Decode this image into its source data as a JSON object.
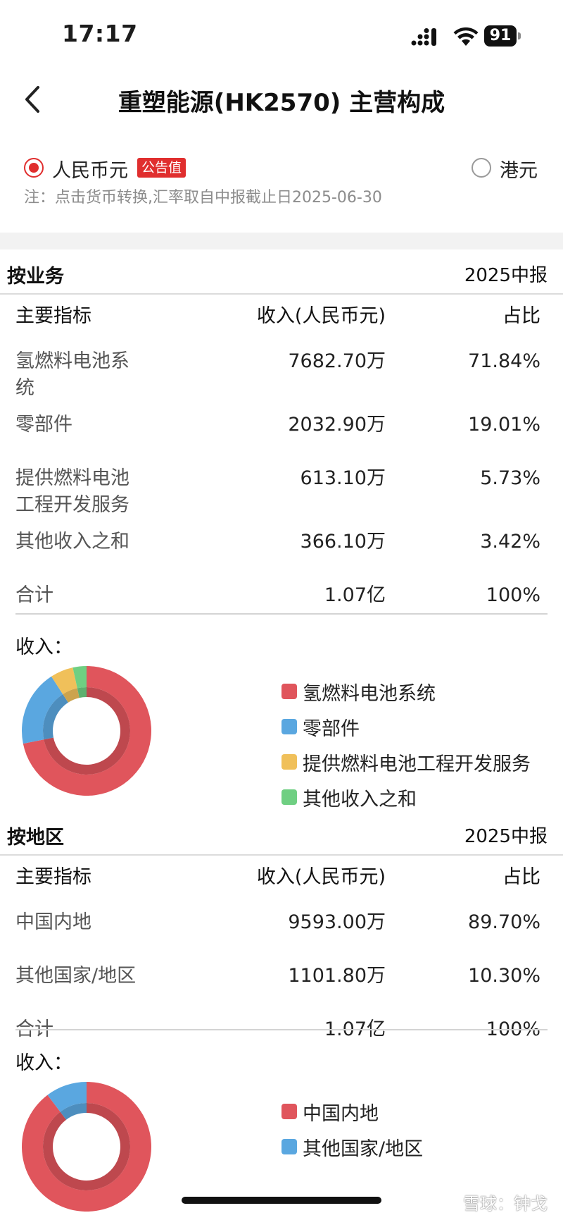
{
  "status": {
    "time": "17:17",
    "battery": "91"
  },
  "nav": {
    "title": "重塑能源(HK2570) 主营构成"
  },
  "currency": {
    "options": [
      {
        "label": "人民币元",
        "badge": "公告值",
        "selected": true
      },
      {
        "label": "港元",
        "selected": false
      }
    ],
    "note": "注：点击货币转换,汇率取自中报截止日2025-06-30"
  },
  "business": {
    "title": "按业务",
    "period": "2025中报",
    "headers": [
      "主要指标",
      "收入(人民币元)",
      "占比"
    ],
    "rows": [
      {
        "name": "氢燃料电池系统",
        "revenue": "7682.70万",
        "ratio": "71.84%"
      },
      {
        "name": "零部件",
        "revenue": "2032.90万",
        "ratio": "19.01%"
      },
      {
        "name": "提供燃料电池工程开发服务",
        "revenue": "613.10万",
        "ratio": "5.73%"
      },
      {
        "name": "其他收入之和",
        "revenue": "366.10万",
        "ratio": "3.42%"
      }
    ],
    "total": {
      "name": "合计",
      "revenue": "1.07亿",
      "ratio": "100%"
    },
    "revenue_label": "收入：",
    "legend": [
      "氢燃料电池系统",
      "零部件",
      "提供燃料电池工程开发服务",
      "其他收入之和"
    ]
  },
  "region": {
    "title": "按地区",
    "period": "2025中报",
    "headers": [
      "主要指标",
      "收入(人民币元)",
      "占比"
    ],
    "rows": [
      {
        "name": "中国内地",
        "revenue": "9593.00万",
        "ratio": "89.70%"
      },
      {
        "name": "其他国家/地区",
        "revenue": "1101.80万",
        "ratio": "10.30%"
      }
    ],
    "total": {
      "name": "合计",
      "revenue": "1.07亿",
      "ratio": "100%"
    },
    "revenue_label": "收入：",
    "legend": [
      "中国内地",
      "其他国家/地区"
    ]
  },
  "chart_data": [
    {
      "type": "pie",
      "categories": [
        "氢燃料电池系统",
        "零部件",
        "提供燃料电池工程开发服务",
        "其他收入之和"
      ],
      "values": [
        71.84,
        19.01,
        5.73,
        3.42
      ],
      "colors": [
        "#e0555c",
        "#5aa7e0",
        "#f0c05a",
        "#6fcf82"
      ],
      "title": "收入："
    },
    {
      "type": "pie",
      "categories": [
        "中国内地",
        "其他国家/地区"
      ],
      "values": [
        89.7,
        10.3
      ],
      "colors": [
        "#e0555c",
        "#5aa7e0"
      ],
      "title": "收入："
    }
  ],
  "watermark": "雪球：钟戈"
}
